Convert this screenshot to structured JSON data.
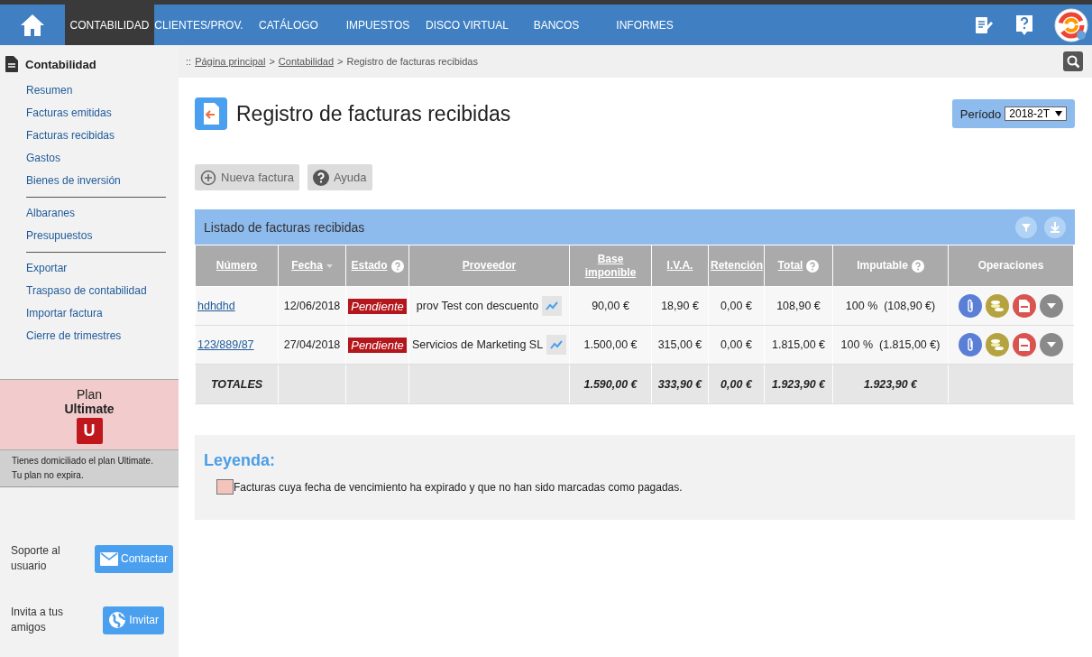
{
  "nav": [
    {
      "label": "CONTABILIDAD",
      "selected": true
    },
    {
      "label": "CLIENTES/PROV.",
      "selected": false
    },
    {
      "label": "CATÁLOGO",
      "selected": false
    },
    {
      "label": "IMPUESTOS",
      "selected": false
    },
    {
      "label": "DISCO VIRTUAL",
      "selected": false
    },
    {
      "label": "BANCOS",
      "selected": false
    },
    {
      "label": "INFORMES",
      "selected": false
    }
  ],
  "sidebar": {
    "title": "Contabilidad",
    "groups": [
      [
        "Resumen",
        "Facturas emitidas",
        "Facturas recibidas",
        "Gastos",
        "Bienes de inversión"
      ],
      [
        "Albaranes",
        "Presupuestos"
      ],
      [
        "Exportar",
        "Traspaso de contabilidad",
        "Importar factura",
        "Cierre de trimestres"
      ]
    ],
    "plan": {
      "label": "Plan",
      "name": "Ultimate",
      "badge": "U",
      "note": [
        "Tienes domiciliado el plan Ultimate.",
        "Tu plan no expira."
      ]
    },
    "support": {
      "text": "Soporte al usuario",
      "button": "Contactar"
    },
    "invite": {
      "text": "Invita a tus amigos",
      "button": "Invitar"
    }
  },
  "breadcrumb": {
    "prefix": "::",
    "links": [
      "Página principal",
      "Contabilidad"
    ],
    "separator": ">",
    "current": "Registro de facturas recibidas"
  },
  "page_title": "Registro de facturas recibidas",
  "period": {
    "label": "Período",
    "value": "2018-2T"
  },
  "toolbar": [
    {
      "kind": "add",
      "label": "Nueva factura"
    },
    {
      "kind": "help",
      "label": "Ayuda"
    }
  ],
  "table": {
    "title": "Listado de facturas recibidas",
    "columns": [
      {
        "label": "Número",
        "link": true,
        "sort": false,
        "help": false
      },
      {
        "label": "Fecha",
        "link": true,
        "sort": true,
        "help": false
      },
      {
        "label": "Estado",
        "link": true,
        "sort": false,
        "help": true
      },
      {
        "label": "Proveedor",
        "link": true,
        "sort": false,
        "help": false
      },
      {
        "label": "Base imponible",
        "link": true,
        "sort": false,
        "help": false
      },
      {
        "label": "I.V.A.",
        "link": true,
        "sort": false,
        "help": false
      },
      {
        "label": "Retención",
        "link": true,
        "sort": false,
        "help": false
      },
      {
        "label": "Total",
        "link": true,
        "sort": false,
        "help": true
      },
      {
        "label": "Imputable",
        "link": false,
        "sort": false,
        "help": true
      },
      {
        "label": "Operaciones",
        "link": false,
        "sort": false,
        "help": false
      }
    ],
    "rows": [
      {
        "numero": "hdhdhd",
        "fecha": "12/06/2018",
        "estado": "Pendiente",
        "proveedor": "prov Test con descuento",
        "base": "90,00 €",
        "iva": "18,90 €",
        "retencion": "0,00 €",
        "total": "108,90 €",
        "imputable": "100 %  (108,90 €)"
      },
      {
        "numero": "123/889/87",
        "fecha": "27/04/2018",
        "estado": "Pendiente",
        "proveedor": "Servicios de Marketing SL",
        "base": "1.500,00 €",
        "iva": "315,00 €",
        "retencion": "0,00 €",
        "total": "1.815,00 €",
        "imputable": "100 %  (1.815,00 €)"
      }
    ],
    "totals": {
      "label": "TOTALES",
      "base": "1.590,00 €",
      "iva": "333,90 €",
      "retencion": "0,00 €",
      "total": "1.923,90 €",
      "imputable": "1.923,90 €"
    }
  },
  "legend": {
    "title": "Leyenda:",
    "items": [
      {
        "color": "#f2c4bc",
        "text": "Facturas cuya fecha de vencimiento ha expirado y que no han sido marcadas como pagadas."
      }
    ]
  }
}
